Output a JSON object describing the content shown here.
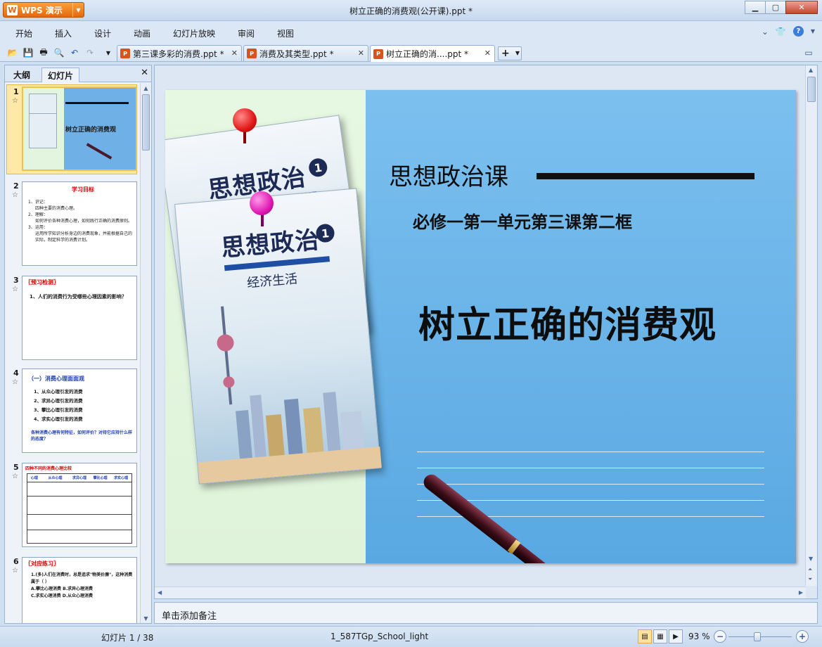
{
  "window": {
    "app_button_label": "WPS 演示",
    "title": "树立正确的消费观(公开课).ppt *"
  },
  "menu": [
    "开始",
    "插入",
    "设计",
    "动画",
    "幻灯片放映",
    "审阅",
    "视图"
  ],
  "tabs": [
    {
      "label": "第三课多彩的消费.ppt *"
    },
    {
      "label": "消费及其类型.ppt *"
    },
    {
      "label": "树立正确的消....ppt *"
    }
  ],
  "panel": {
    "tab_outline": "大纲",
    "tab_slides": "幻灯片",
    "thumbnails": [
      {
        "num": "1",
        "text": "树立正确的消费观"
      },
      {
        "num": "2",
        "heading": "学习目标",
        "lines": [
          "1、识记：",
          "四种主要的消费心理。",
          "2、理解：",
          "如何评价各种消费心理，如何践行正确的消费原则。",
          "3、运用：",
          "运用所学知识分析身边的消费现象，并能根据自己的实际，制定科学的消费计划。"
        ]
      },
      {
        "num": "3",
        "heading": "〖预习检测〗",
        "lines": [
          "1、人们的消费行为受哪些心理因素的影响？"
        ]
      },
      {
        "num": "4",
        "heading": "（一）消费心理面面观",
        "lines": [
          "1、从众心理引发的消费",
          "2、求异心理引发的消费",
          "3、攀比心理引发的消费",
          "4、求实心理引发的消费",
          "各种消费心理有何特征，如何评价？对待它应持什么样的态度？"
        ]
      },
      {
        "num": "5",
        "heading": "四种不同的消费心理比较",
        "lines": [
          "心理",
          "从众心理",
          "求异心理",
          "攀比心理",
          "求实心理"
        ]
      },
      {
        "num": "6",
        "heading": "〖对应练习〗",
        "lines": [
          "1.(多)人们在消费时，总是追求\"物美价廉\"，这种消费属于（ ）",
          "A.攀比心理消费   B.求异心理消费",
          "C.求实心理消费   D.从众心理消费"
        ]
      }
    ]
  },
  "slide": {
    "title": "思想政治课",
    "subtitle": "必修一第一单元第三课第二框",
    "main_title": "树立正确的消费观",
    "book_title": "思想政治",
    "book_number": "1",
    "book_subtitle": "经济生活"
  },
  "notes": {
    "placeholder": "单击添加备注"
  },
  "status": {
    "slide_counter": "幻灯片 1 / 38",
    "template": "1_587TGp_School_light",
    "zoom": "93 %"
  },
  "colors": {
    "accent_orange": "#e4680c",
    "ui_blue": "#dbe7f5",
    "slide_blue": "#6fb1e6"
  }
}
